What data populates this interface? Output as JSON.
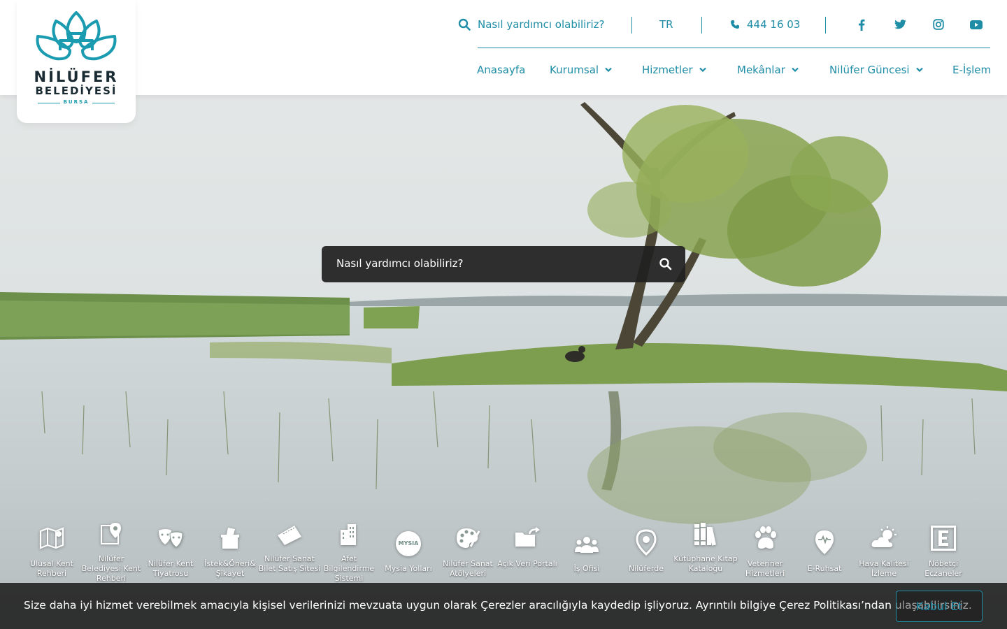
{
  "logo": {
    "name_line1": "NİLÜFER",
    "name_line2": "BELEDİYESİ",
    "city": "BURSA"
  },
  "topbar": {
    "search_label": "Nasıl yardımcı olabiliriz?",
    "language": "TR",
    "phone": "444 16 03",
    "social": [
      "facebook-icon",
      "twitter-icon",
      "instagram-icon",
      "youtube-icon"
    ]
  },
  "nav": {
    "items": [
      {
        "label": "Anasayfa"
      },
      {
        "label": "Kurumsal"
      },
      {
        "label": "Hizmetler"
      },
      {
        "label": "Mekânlar"
      },
      {
        "label": "Nilüfer Güncesi"
      },
      {
        "label": "E-İşlem"
      }
    ]
  },
  "search": {
    "placeholder": "Nasıl yardımcı olabiliriz?"
  },
  "quick_links": [
    {
      "label": "Ulusal Kent Rehberi",
      "icon": "map-icon"
    },
    {
      "label": "Nilüfer Belediyesi Kent Rehberi",
      "icon": "map-pin-icon"
    },
    {
      "label": "Nilüfer Kent Tiyatrosu",
      "icon": "theatre-masks-icon"
    },
    {
      "label": "İstek&Öneri& Şikayet",
      "icon": "ballot-box-icon"
    },
    {
      "label": "Nilüfer Sanat Bilet Satış Sitesi",
      "icon": "ticket-icon"
    },
    {
      "label": "Afet Bilgilendirme Sistemi",
      "icon": "building-icon"
    },
    {
      "label": "Mysia Yolları",
      "icon": "mysia-badge-icon"
    },
    {
      "label": "Nilüfer Sanat Atölyeleri",
      "icon": "palette-icon"
    },
    {
      "label": "Açık Veri Portalı",
      "icon": "folder-icon"
    },
    {
      "label": "İş Ofisi",
      "icon": "people-icon"
    },
    {
      "label": "Nilüferde",
      "icon": "location-icon"
    },
    {
      "label": "Kütüphane Kitap Kataloğu",
      "icon": "books-icon"
    },
    {
      "label": "Veteriner Hizmetleri",
      "icon": "paw-icon"
    },
    {
      "label": "E-Ruhsat",
      "icon": "pulse-pin-icon"
    },
    {
      "label": "Hava Kalitesi İzleme",
      "icon": "weather-icon"
    },
    {
      "label": "Nöbetçi Eczaneler",
      "icon": "pharmacy-e-icon"
    }
  ],
  "cookie": {
    "text": "Size daha iyi hizmet verebilmek amacıyla kişisel verilerinizi mevzuata uygun olarak Çerezler aracılığıyla kaydedip işliyoruz. Ayrıntılı bilgiye Çerez Politikası’ndan ulaşabilirsiniz.",
    "accept_label": "Kabul Et"
  },
  "colors": {
    "brand": "#1f8da6",
    "brand_light": "#1a9bb0",
    "dark": "#1b2b33"
  }
}
